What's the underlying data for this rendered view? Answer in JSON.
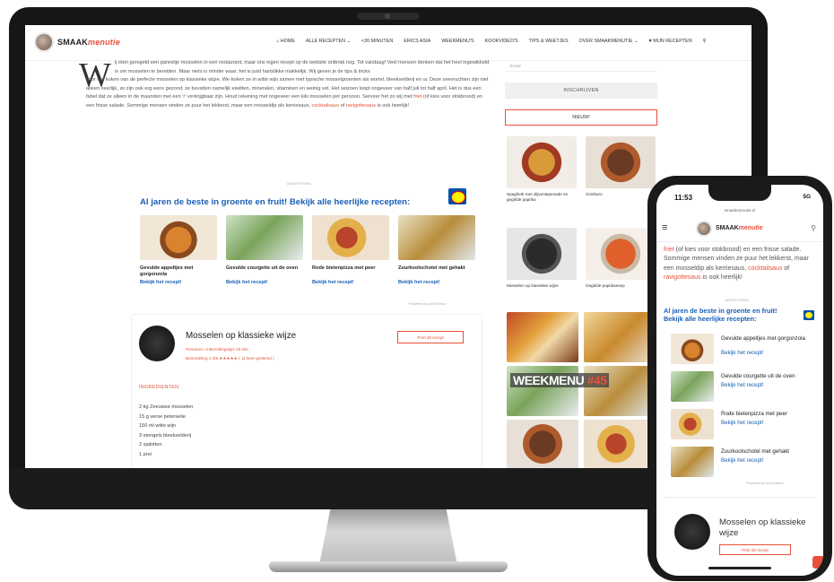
{
  "site": {
    "brand_main": "SMAAK",
    "brand_accent": "menutie"
  },
  "nav": {
    "items": [
      "HOME",
      "ALLE RECEPTEN",
      "<30 MINUTEN",
      "ERICS ASIA",
      "WEEKMENU'S",
      "KOOKVIDEO'S",
      "TIPS & WEETJES",
      "OVER SMAAKMENUTIE",
      "MIJN RECEPTEN"
    ]
  },
  "article": {
    "dropcap": "W",
    "lead": "ij eten geregeld een pannetje mosselen in een restaurant, maar ons eigen recept op de website ontbrak nog. Tot vandaag! Veel mensen denken dat het heel ingewikkeld is om mosselen te bereiden. Maar niets is minder waar, het is juist hartstikke makkelijk. Wij geven je de tips & tricks",
    "body": "voor het koken van de perfecte mosselen op klassieke wijze. We koken ze in witte wijn samen met typische mosselgroenten als wortel, bleekselderij en ui. Deze zeevruchten zijn niet alleen heerlijk, ze zijn ook erg eens gezond; ze bevatten namelijk eiwitten, mineralen, vitaminen en weinig vet. Het seizoen loopt ongeveer van half juli tot half april. Het is dus een fabel dat ze alleen in de maanden met een 'r' verkrijgbaar zijn. Houd rekening met ongeveer een kilo mosselen per persoon. Serveer het zo wij met",
    "link1": "friet",
    "body2": "(of kies voor stokbrood) en een frisse salade. Sommige mensen vinden ze puur het lekkerst, maar een mosseldip als kerriesaus,",
    "link2": "cocktailsaus",
    "of": "of",
    "link3": "ravigottesaus",
    "end": "is ook heerlijk!",
    "ad_label": "ADVERTISING"
  },
  "promo": {
    "title": "Al jaren de beste in groente en fruit! Bekijk alle heerlijke recepten:",
    "cards": [
      {
        "name": "Gevulde appeltjes met gorgonzola",
        "link": "Bekijk het recept!"
      },
      {
        "name": "Gevulde courgette uit de oven",
        "link": "Bekijk het recept!"
      },
      {
        "name": "Rode bietenpizza met peer",
        "link": "Bekijk het recept!"
      },
      {
        "name": "Zuurkoolschotel met gehakt",
        "link": "Bekijk het recept!"
      }
    ],
    "powered": "Powered by Ad Exterior"
  },
  "recipe": {
    "title": "Mosselen op klassieke wijze",
    "meta": "Personen: 4   Bereidingstijd: 20 min",
    "rating": "Beoordeling 4.3/5   ★★★★★   ( 11 keer gestemd )",
    "print": "Print dit recept",
    "ingredients_header": "INGREDIENTEN",
    "ingredients": [
      "2 kg Zeeuwse mosselen",
      "15 g verse peterselie",
      "150 ml witte wijn",
      "3 stengels bleekselderij",
      "2 sjalotten",
      "1 prei"
    ]
  },
  "sidebar": {
    "email_placeholder": "Email",
    "subscribe": "INSCHRIJVEN",
    "new_label": "NIEUW!",
    "tiles": [
      {
        "caption": "Spaghetti met olijventapenade en gegrilde paprika"
      },
      {
        "caption": "Ocinburo"
      },
      {
        "caption": "Mosselen op klassieke wijze"
      },
      {
        "caption": "Gegrilde paprikasoep"
      }
    ],
    "weekmenu_word": "WEEKMENU",
    "weekmenu_num": "#45"
  },
  "phone": {
    "time": "11:53",
    "signal": "5G",
    "url": "smaakmenutie.nl",
    "para_start": "friet",
    "para_body": "(of kies voor stokbrood) en een frisse salade. Sommige mensen vinden ze puur het lekkerst, maar een mosseldip als kerriesaus,",
    "para_link": "cocktailsaus",
    "para_of": "of",
    "para_link2": "ravigottesaus",
    "para_end": "is ook heerlijk!",
    "ad_label": "ADVERTISING",
    "promo_title": "Al jaren de beste in groente en fruit! Bekijk alle heerlijke recepten:",
    "items": [
      {
        "name": "Gevulde appeltjes met gorgonzola",
        "link": "Bekijk het recept!"
      },
      {
        "name": "Gevulde courgette uit de oven",
        "link": "Bekijk het recept!"
      },
      {
        "name": "Rode bietenpizza met peer",
        "link": "Bekijk het recept!"
      },
      {
        "name": "Zuurkoolschotel met gehakt",
        "link": "Bekijk het recept!"
      }
    ],
    "powered": "Powered by Ad Exterior",
    "card_title": "Mosselen op klassieke wijze",
    "print": "Print dit recept"
  },
  "colors": {
    "accent": "#e8503a",
    "link_blue": "#1a5fb4",
    "lidl_blue": "#0050aa",
    "lidl_yellow": "#fff200"
  }
}
